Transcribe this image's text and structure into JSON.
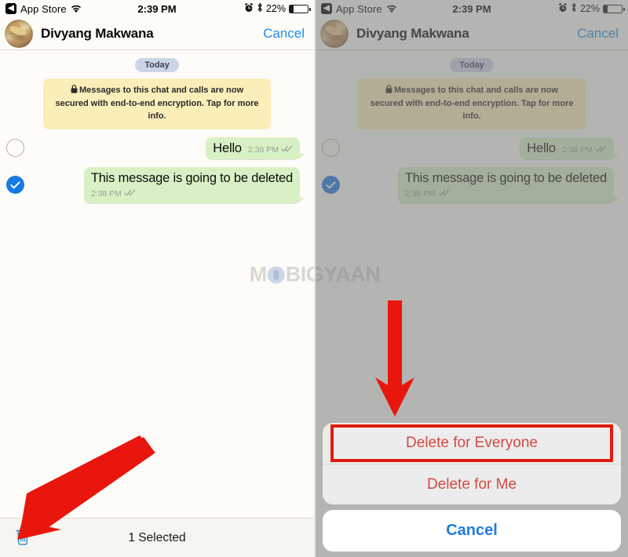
{
  "status_bar": {
    "back_label": "App Store",
    "back_icon": "chevron-left-icon",
    "wifi_icon": "wifi-icon",
    "time": "2:39 PM",
    "alarm_icon": "alarm-icon",
    "bluetooth_icon": "bluetooth-icon",
    "battery_percent": "22%",
    "battery_icon": "battery-icon",
    "battery_level": 22
  },
  "navbar": {
    "avatar": "contact-avatar",
    "contact_name": "Divyang Makwana",
    "cancel_label": "Cancel"
  },
  "chat": {
    "day_divider": "Today",
    "encryption_notice": "Messages to this chat and calls are now secured with end-to-end encryption. Tap for more info.",
    "lock_icon": "lock-icon",
    "messages": [
      {
        "text": "Hello",
        "time": "2:38 PM",
        "ticks": "double-check-icon",
        "selected": false,
        "selection_icon": "unchecked-circle-icon"
      },
      {
        "text": "This message is going to be deleted",
        "time": "2:38 PM",
        "ticks": "double-check-icon",
        "selected": true,
        "selection_icon": "checked-circle-icon"
      }
    ]
  },
  "toolbar": {
    "trash_icon": "trash-icon",
    "status_text": "1 Selected"
  },
  "action_sheet": {
    "options": [
      {
        "label": "Delete for Everyone",
        "highlighted": true
      },
      {
        "label": "Delete for Me",
        "highlighted": false
      }
    ],
    "cancel_label": "Cancel"
  },
  "watermark": {
    "prefix": "M",
    "logo": "mobigyaan-logo-icon",
    "suffix": "BIGYAAN"
  },
  "annotations": {
    "left_arrow": "red-arrow-pointing-to-trash",
    "right_arrow": "red-arrow-pointing-to-delete-for-everyone"
  },
  "colors": {
    "accent_blue": "#1e8ef0",
    "bubble_green": "#d8f1c4",
    "encryption_yellow": "#faeeb9",
    "day_pill": "#ccd5e6",
    "destructive_red": "#d34a42",
    "annotation_red": "#e8160c",
    "dim_overlay": "rgba(120,120,120,0.55)"
  }
}
